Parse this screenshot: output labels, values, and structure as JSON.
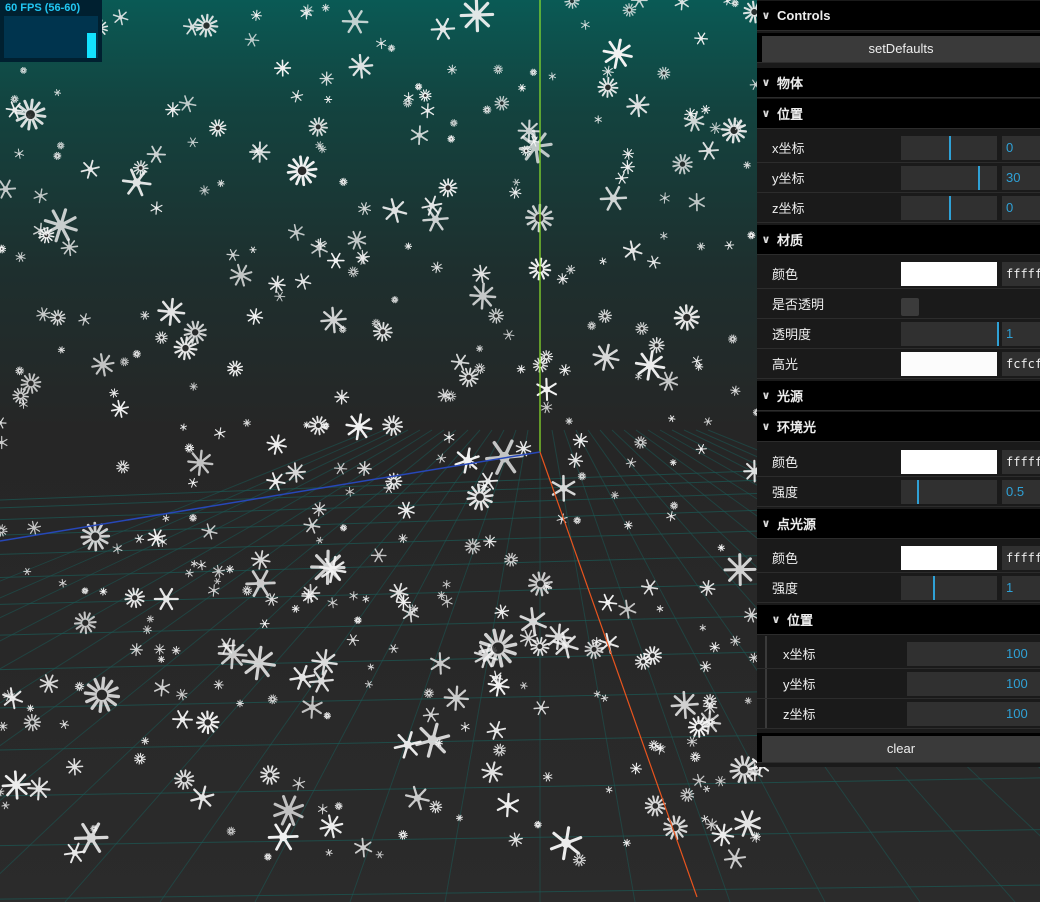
{
  "stats": {
    "fps_text": "60 FPS (56-60)",
    "fps_level": 0.6
  },
  "gui": {
    "header_title": "Controls",
    "set_defaults_label": "setDefaults",
    "object_folder": "物体",
    "position_folder": "位置",
    "position": {
      "x_label": "x坐标",
      "x_value": "0",
      "x_fill": 0.5,
      "y_label": "y坐标",
      "y_value": "30",
      "y_fill": 0.8,
      "z_label": "z坐标",
      "z_value": "0",
      "z_fill": 0.5
    },
    "material_folder": "材质",
    "material": {
      "color_label": "颜色",
      "color_hex": "ffffff",
      "color_swatch": "#ffffff",
      "transparent_label": "是否透明",
      "opacity_label": "透明度",
      "opacity_value": "1",
      "opacity_fill": 1.0,
      "specular_label": "高光",
      "specular_hex": "fcfcfc",
      "specular_swatch": "#fcfcfc"
    },
    "light_folder": "光源",
    "ambient_folder": "环境光",
    "ambient": {
      "color_label": "颜色",
      "color_hex": "ffffff",
      "color_swatch": "#ffffff",
      "intensity_label": "强度",
      "intensity_value": "0.5",
      "intensity_fill": 0.17
    },
    "point_folder": "点光源",
    "point": {
      "color_label": "颜色",
      "color_hex": "ffffff",
      "color_swatch": "#ffffff",
      "intensity_label": "强度",
      "intensity_value": "1",
      "intensity_fill": 0.33,
      "position_folder": "位置",
      "x_label": "x坐标",
      "x_value": "100",
      "x_fill": 1.0,
      "y_label": "y坐标",
      "y_value": "100",
      "y_fill": 1.0,
      "z_label": "z坐标",
      "z_value": "100",
      "z_fill": 1.0
    },
    "clear_label": "clear"
  },
  "colors": {
    "accent": "#2fa1d6",
    "axis_x": "#e8541e",
    "axis_y": "#8ee62b",
    "axis_z": "#2747b8",
    "grid": "#1b5a55",
    "sky_top": "#0a5a55",
    "ground": "#2b2b2b"
  },
  "scene": {
    "icon": "snowflake-icon"
  }
}
